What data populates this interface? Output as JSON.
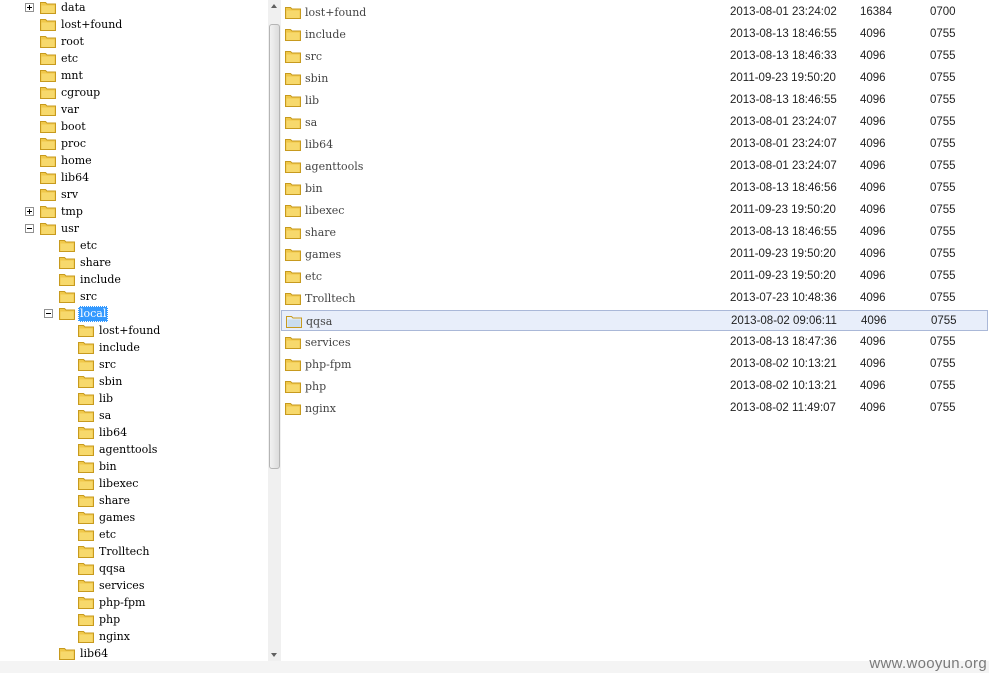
{
  "icons": {
    "folder": "folder-icon",
    "expand": "plus-box-icon",
    "collapse": "minus-box-icon"
  },
  "colors": {
    "folder_fill": "#f7d96c",
    "folder_edge": "#c79a1e",
    "selection": "#3399ff",
    "list_selection": "#e8eefa"
  },
  "tree": [
    {
      "label": "data",
      "level": 0,
      "toggle": "plus"
    },
    {
      "label": "lost+found",
      "level": 0,
      "toggle": "none"
    },
    {
      "label": "root",
      "level": 0,
      "toggle": "none"
    },
    {
      "label": "etc",
      "level": 0,
      "toggle": "none"
    },
    {
      "label": "mnt",
      "level": 0,
      "toggle": "none"
    },
    {
      "label": "cgroup",
      "level": 0,
      "toggle": "none"
    },
    {
      "label": "var",
      "level": 0,
      "toggle": "none"
    },
    {
      "label": "boot",
      "level": 0,
      "toggle": "none"
    },
    {
      "label": "proc",
      "level": 0,
      "toggle": "none"
    },
    {
      "label": "home",
      "level": 0,
      "toggle": "none"
    },
    {
      "label": "lib64",
      "level": 0,
      "toggle": "none"
    },
    {
      "label": "srv",
      "level": 0,
      "toggle": "none"
    },
    {
      "label": "tmp",
      "level": 0,
      "toggle": "plus"
    },
    {
      "label": "usr",
      "level": 0,
      "toggle": "minus"
    },
    {
      "label": "etc",
      "level": 1,
      "toggle": "none"
    },
    {
      "label": "share",
      "level": 1,
      "toggle": "none"
    },
    {
      "label": "include",
      "level": 1,
      "toggle": "none"
    },
    {
      "label": "src",
      "level": 1,
      "toggle": "none"
    },
    {
      "label": "local",
      "level": 1,
      "toggle": "minus",
      "selected": true
    },
    {
      "label": "lost+found",
      "level": 2,
      "toggle": "none"
    },
    {
      "label": "include",
      "level": 2,
      "toggle": "none"
    },
    {
      "label": "src",
      "level": 2,
      "toggle": "none"
    },
    {
      "label": "sbin",
      "level": 2,
      "toggle": "none"
    },
    {
      "label": "lib",
      "level": 2,
      "toggle": "none"
    },
    {
      "label": "sa",
      "level": 2,
      "toggle": "none"
    },
    {
      "label": "lib64",
      "level": 2,
      "toggle": "none"
    },
    {
      "label": "agenttools",
      "level": 2,
      "toggle": "none"
    },
    {
      "label": "bin",
      "level": 2,
      "toggle": "none"
    },
    {
      "label": "libexec",
      "level": 2,
      "toggle": "none"
    },
    {
      "label": "share",
      "level": 2,
      "toggle": "none"
    },
    {
      "label": "games",
      "level": 2,
      "toggle": "none"
    },
    {
      "label": "etc",
      "level": 2,
      "toggle": "none"
    },
    {
      "label": "Trolltech",
      "level": 2,
      "toggle": "none"
    },
    {
      "label": "qqsa",
      "level": 2,
      "toggle": "none"
    },
    {
      "label": "services",
      "level": 2,
      "toggle": "none"
    },
    {
      "label": "php-fpm",
      "level": 2,
      "toggle": "none"
    },
    {
      "label": "php",
      "level": 2,
      "toggle": "none"
    },
    {
      "label": "nginx",
      "level": 2,
      "toggle": "none"
    },
    {
      "label": "lib64",
      "level": 1,
      "toggle": "none"
    }
  ],
  "files": [
    {
      "name": "lost+found",
      "date": "2013-08-01 23:24:02",
      "size": "16384",
      "perm": "0700"
    },
    {
      "name": "include",
      "date": "2013-08-13 18:46:55",
      "size": "4096",
      "perm": "0755"
    },
    {
      "name": "src",
      "date": "2013-08-13 18:46:33",
      "size": "4096",
      "perm": "0755"
    },
    {
      "name": "sbin",
      "date": "2011-09-23 19:50:20",
      "size": "4096",
      "perm": "0755"
    },
    {
      "name": "lib",
      "date": "2013-08-13 18:46:55",
      "size": "4096",
      "perm": "0755"
    },
    {
      "name": "sa",
      "date": "2013-08-01 23:24:07",
      "size": "4096",
      "perm": "0755"
    },
    {
      "name": "lib64",
      "date": "2013-08-01 23:24:07",
      "size": "4096",
      "perm": "0755"
    },
    {
      "name": "agenttools",
      "date": "2013-08-01 23:24:07",
      "size": "4096",
      "perm": "0755"
    },
    {
      "name": "bin",
      "date": "2013-08-13 18:46:56",
      "size": "4096",
      "perm": "0755"
    },
    {
      "name": "libexec",
      "date": "2011-09-23 19:50:20",
      "size": "4096",
      "perm": "0755"
    },
    {
      "name": "share",
      "date": "2013-08-13 18:46:55",
      "size": "4096",
      "perm": "0755"
    },
    {
      "name": "games",
      "date": "2011-09-23 19:50:20",
      "size": "4096",
      "perm": "0755"
    },
    {
      "name": "etc",
      "date": "2011-09-23 19:50:20",
      "size": "4096",
      "perm": "0755"
    },
    {
      "name": "Trolltech",
      "date": "2013-07-23 10:48:36",
      "size": "4096",
      "perm": "0755"
    },
    {
      "name": "qqsa",
      "date": "2013-08-02 09:06:11",
      "size": "4096",
      "perm": "0755",
      "selected": true
    },
    {
      "name": "services",
      "date": "2013-08-13 18:47:36",
      "size": "4096",
      "perm": "0755"
    },
    {
      "name": "php-fpm",
      "date": "2013-08-02 10:13:21",
      "size": "4096",
      "perm": "0755"
    },
    {
      "name": "php",
      "date": "2013-08-02 10:13:21",
      "size": "4096",
      "perm": "0755"
    },
    {
      "name": "nginx",
      "date": "2013-08-02 11:49:07",
      "size": "4096",
      "perm": "0755"
    }
  ],
  "watermark": "www.wooyun.org"
}
